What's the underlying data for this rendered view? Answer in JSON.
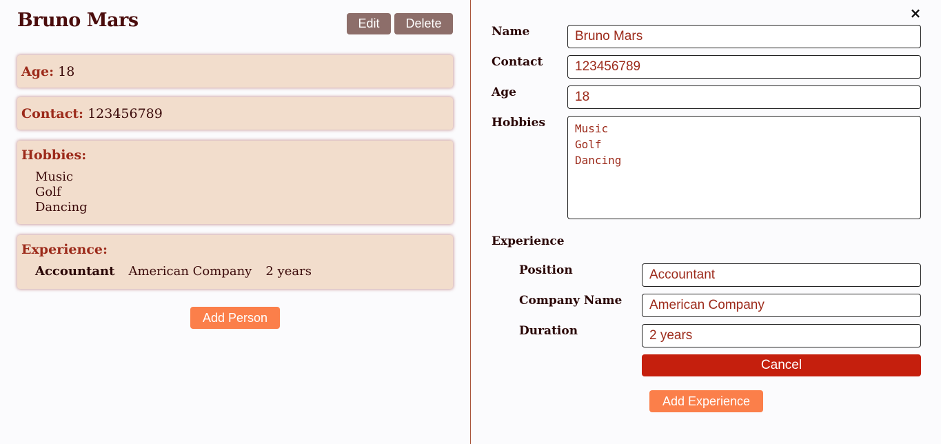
{
  "person": {
    "name": "Bruno Mars",
    "age_label": "Age:",
    "age": "18",
    "contact_label": "Contact:",
    "contact": "123456789",
    "hobbies_label": "Hobbies:",
    "hobbies": [
      "Music",
      "Golf",
      "Dancing"
    ],
    "experience_label": "Experience:",
    "experience": [
      {
        "position": "Accountant",
        "company": "American Company",
        "duration": "2 years"
      }
    ]
  },
  "actions": {
    "edit_label": "Edit",
    "delete_label": "Delete",
    "add_person_label": "Add Person"
  },
  "form": {
    "close_icon": "×",
    "name_label": "Name",
    "name_value": "Bruno Mars",
    "contact_label": "Contact",
    "contact_value": "123456789",
    "age_label": "Age",
    "age_value": "18",
    "hobbies_label": "Hobbies",
    "hobbies_value": [
      "Music",
      "Golf",
      "Dancing"
    ],
    "experience_label": "Experience",
    "position_label": "Position",
    "position_value": "Accountant",
    "company_label": "Company Name",
    "company_value": "American Company",
    "duration_label": "Duration",
    "duration_value": "2 years",
    "cancel_label": "Cancel",
    "add_experience_label": "Add Experience"
  },
  "colors": {
    "accent_orange": "#fb7f4a",
    "cancel_red": "#c51f0d",
    "card_bg": "#f2ddcc",
    "label_red": "#9c2a1a",
    "neutral_button": "#8d6e6a"
  }
}
